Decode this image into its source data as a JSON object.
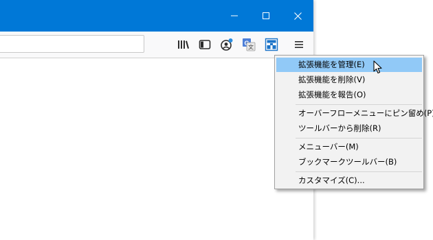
{
  "window": {
    "controls": {
      "minimize_icon": "minimize-icon",
      "maximize_icon": "maximize-icon",
      "close_icon": "close-icon"
    }
  },
  "toolbar": {
    "urlbar_value": "",
    "icons": [
      "library-icon",
      "sidebar-icon",
      "account-icon",
      "translate-icon",
      "extension-icon",
      "hamburger-menu-icon"
    ]
  },
  "context_menu": {
    "items": [
      {
        "label": "拡張機能を管理(E)",
        "highlighted": true
      },
      {
        "label": "拡張機能を削除(V)"
      },
      {
        "label": "拡張機能を報告(O)"
      },
      {
        "label": "オーバーフローメニューにピン留め(P)"
      },
      {
        "label": "ツールバーから削除(R)"
      },
      {
        "label": "メニューバー(M)"
      },
      {
        "label": "ブックマークツールバー(B)"
      },
      {
        "label": "カスタマイズ(C)..."
      }
    ]
  },
  "colors": {
    "titlebar": "#0078d7",
    "highlight": "#91c9f7",
    "menu_bg": "#f2f2f2",
    "badge": "#2b8cde"
  }
}
